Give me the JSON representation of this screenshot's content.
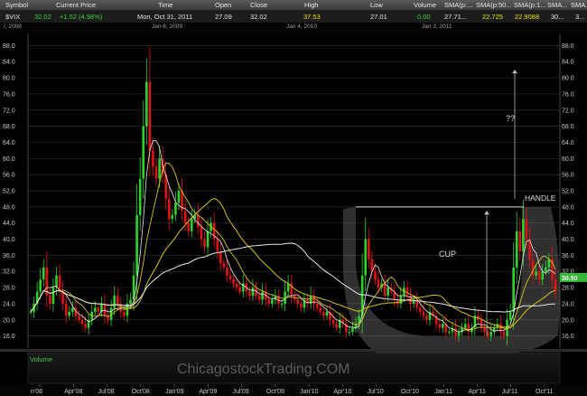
{
  "header": {
    "columns": [
      "Symbol",
      "Current Price",
      "Time",
      "Open",
      "Close",
      "High",
      "Low",
      "Volume",
      "SMA(p:...",
      "SMA(p:50...",
      "SMA(p:1...",
      "SMA...",
      "SMA..."
    ]
  },
  "quote": {
    "symbol": "$VIX",
    "price": "32.02",
    "change": "+1.52 (4.98%)",
    "time": "Mon, Oct 31, 2011",
    "open": "27.09",
    "close": "32.02",
    "high": "37.53",
    "low": "27.01",
    "volume": "0.00",
    "sma1": "27.71...",
    "sma2": "22.725",
    "sma3": "22.9088",
    "sma4": "30...",
    "sma5": "3..."
  },
  "date_bar": [
    "/, 2008",
    "Jan 6, 2009",
    "Jan 4, 2010",
    "Jan 3, 2011"
  ],
  "annotations": {
    "cup": "CUP",
    "handle": "HANDLE",
    "question": "??"
  },
  "volume_label": "Volume",
  "watermark": "ChicagostockTrading.COM",
  "colors": {
    "up": "#2fd12f",
    "down": "#e01414",
    "sma_white": "#e8e8e8",
    "sma_yellow": "#d4c21a",
    "grid": "#2a2a2a",
    "axis_text": "#c8c8c8",
    "price_tag": "#35b835"
  },
  "chart_data": {
    "type": "candlestick",
    "title": "",
    "ylim": [
      13,
      91
    ],
    "yticks": [
      "16.0",
      "20.0",
      "24.0",
      "28.0",
      "32.0",
      "36.0",
      "40.0",
      "44.0",
      "48.0",
      "52.0",
      "56.0",
      "60.0",
      "64.0",
      "68.0",
      "72.0",
      "76.0",
      "80.0",
      "84.0",
      "88.0"
    ],
    "x_tick_labels": [
      "n'08",
      "Apr'08",
      "Jul'08",
      "Oct'08",
      "Jan'09",
      "Apr'09",
      "Jul'09",
      "Oct'09",
      "Jan'10",
      "Apr'10",
      "Jul'10",
      "Oct'10",
      "Jan'11",
      "Apr'11",
      "Jul'11",
      "Oct'11"
    ],
    "last_price_label": "30.50",
    "last_price": 30.5,
    "candles_close": [
      22,
      24,
      27,
      30,
      33,
      26,
      24,
      28,
      31,
      27,
      24,
      21,
      22,
      23,
      21,
      20,
      19,
      18,
      20,
      22,
      23,
      22,
      24,
      21,
      20,
      23,
      26,
      24,
      22,
      21,
      24,
      25,
      31,
      46,
      55,
      68,
      79,
      62,
      58,
      55,
      60,
      56,
      50,
      45,
      46,
      49,
      52,
      47,
      44,
      42,
      45,
      46,
      43,
      40,
      38,
      42,
      44,
      40,
      37,
      34,
      33,
      31,
      30,
      29,
      28,
      27,
      29,
      27,
      26,
      28,
      26,
      25,
      27,
      25,
      24,
      25,
      26,
      24,
      24,
      27,
      29,
      26,
      25,
      24,
      23,
      25,
      24,
      26,
      24,
      23,
      22,
      21,
      22,
      20,
      19,
      18,
      20,
      19,
      17,
      17,
      18,
      19,
      21,
      31,
      40,
      35,
      32,
      30,
      28,
      29,
      26,
      28,
      27,
      25,
      24,
      26,
      28,
      26,
      24,
      25,
      23,
      22,
      21,
      20,
      22,
      21,
      19,
      18,
      19,
      17,
      17,
      18,
      16,
      17,
      18,
      19,
      17,
      18,
      21,
      20,
      18,
      17,
      16,
      17,
      18,
      19,
      17,
      16,
      20,
      22,
      33,
      42,
      37,
      45,
      40,
      35,
      31,
      32,
      30,
      32,
      33,
      35,
      30,
      27
    ]
  }
}
